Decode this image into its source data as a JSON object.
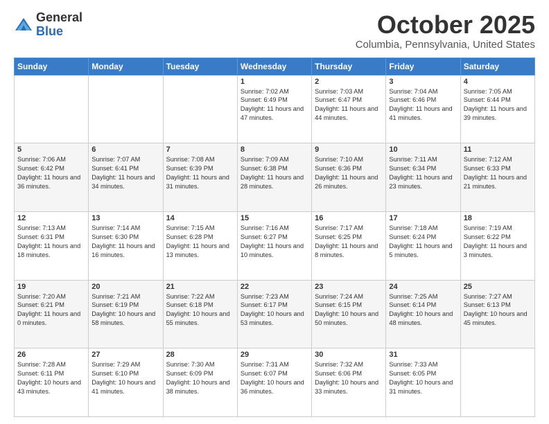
{
  "header": {
    "logo_general": "General",
    "logo_blue": "Blue",
    "month": "October 2025",
    "location": "Columbia, Pennsylvania, United States"
  },
  "days_of_week": [
    "Sunday",
    "Monday",
    "Tuesday",
    "Wednesday",
    "Thursday",
    "Friday",
    "Saturday"
  ],
  "weeks": [
    [
      {
        "day": "",
        "info": ""
      },
      {
        "day": "",
        "info": ""
      },
      {
        "day": "",
        "info": ""
      },
      {
        "day": "1",
        "info": "Sunrise: 7:02 AM\nSunset: 6:49 PM\nDaylight: 11 hours and 47 minutes."
      },
      {
        "day": "2",
        "info": "Sunrise: 7:03 AM\nSunset: 6:47 PM\nDaylight: 11 hours and 44 minutes."
      },
      {
        "day": "3",
        "info": "Sunrise: 7:04 AM\nSunset: 6:46 PM\nDaylight: 11 hours and 41 minutes."
      },
      {
        "day": "4",
        "info": "Sunrise: 7:05 AM\nSunset: 6:44 PM\nDaylight: 11 hours and 39 minutes."
      }
    ],
    [
      {
        "day": "5",
        "info": "Sunrise: 7:06 AM\nSunset: 6:42 PM\nDaylight: 11 hours and 36 minutes."
      },
      {
        "day": "6",
        "info": "Sunrise: 7:07 AM\nSunset: 6:41 PM\nDaylight: 11 hours and 34 minutes."
      },
      {
        "day": "7",
        "info": "Sunrise: 7:08 AM\nSunset: 6:39 PM\nDaylight: 11 hours and 31 minutes."
      },
      {
        "day": "8",
        "info": "Sunrise: 7:09 AM\nSunset: 6:38 PM\nDaylight: 11 hours and 28 minutes."
      },
      {
        "day": "9",
        "info": "Sunrise: 7:10 AM\nSunset: 6:36 PM\nDaylight: 11 hours and 26 minutes."
      },
      {
        "day": "10",
        "info": "Sunrise: 7:11 AM\nSunset: 6:34 PM\nDaylight: 11 hours and 23 minutes."
      },
      {
        "day": "11",
        "info": "Sunrise: 7:12 AM\nSunset: 6:33 PM\nDaylight: 11 hours and 21 minutes."
      }
    ],
    [
      {
        "day": "12",
        "info": "Sunrise: 7:13 AM\nSunset: 6:31 PM\nDaylight: 11 hours and 18 minutes."
      },
      {
        "day": "13",
        "info": "Sunrise: 7:14 AM\nSunset: 6:30 PM\nDaylight: 11 hours and 16 minutes."
      },
      {
        "day": "14",
        "info": "Sunrise: 7:15 AM\nSunset: 6:28 PM\nDaylight: 11 hours and 13 minutes."
      },
      {
        "day": "15",
        "info": "Sunrise: 7:16 AM\nSunset: 6:27 PM\nDaylight: 11 hours and 10 minutes."
      },
      {
        "day": "16",
        "info": "Sunrise: 7:17 AM\nSunset: 6:25 PM\nDaylight: 11 hours and 8 minutes."
      },
      {
        "day": "17",
        "info": "Sunrise: 7:18 AM\nSunset: 6:24 PM\nDaylight: 11 hours and 5 minutes."
      },
      {
        "day": "18",
        "info": "Sunrise: 7:19 AM\nSunset: 6:22 PM\nDaylight: 11 hours and 3 minutes."
      }
    ],
    [
      {
        "day": "19",
        "info": "Sunrise: 7:20 AM\nSunset: 6:21 PM\nDaylight: 11 hours and 0 minutes."
      },
      {
        "day": "20",
        "info": "Sunrise: 7:21 AM\nSunset: 6:19 PM\nDaylight: 10 hours and 58 minutes."
      },
      {
        "day": "21",
        "info": "Sunrise: 7:22 AM\nSunset: 6:18 PM\nDaylight: 10 hours and 55 minutes."
      },
      {
        "day": "22",
        "info": "Sunrise: 7:23 AM\nSunset: 6:17 PM\nDaylight: 10 hours and 53 minutes."
      },
      {
        "day": "23",
        "info": "Sunrise: 7:24 AM\nSunset: 6:15 PM\nDaylight: 10 hours and 50 minutes."
      },
      {
        "day": "24",
        "info": "Sunrise: 7:25 AM\nSunset: 6:14 PM\nDaylight: 10 hours and 48 minutes."
      },
      {
        "day": "25",
        "info": "Sunrise: 7:27 AM\nSunset: 6:13 PM\nDaylight: 10 hours and 45 minutes."
      }
    ],
    [
      {
        "day": "26",
        "info": "Sunrise: 7:28 AM\nSunset: 6:11 PM\nDaylight: 10 hours and 43 minutes."
      },
      {
        "day": "27",
        "info": "Sunrise: 7:29 AM\nSunset: 6:10 PM\nDaylight: 10 hours and 41 minutes."
      },
      {
        "day": "28",
        "info": "Sunrise: 7:30 AM\nSunset: 6:09 PM\nDaylight: 10 hours and 38 minutes."
      },
      {
        "day": "29",
        "info": "Sunrise: 7:31 AM\nSunset: 6:07 PM\nDaylight: 10 hours and 36 minutes."
      },
      {
        "day": "30",
        "info": "Sunrise: 7:32 AM\nSunset: 6:06 PM\nDaylight: 10 hours and 33 minutes."
      },
      {
        "day": "31",
        "info": "Sunrise: 7:33 AM\nSunset: 6:05 PM\nDaylight: 10 hours and 31 minutes."
      },
      {
        "day": "",
        "info": ""
      }
    ]
  ]
}
